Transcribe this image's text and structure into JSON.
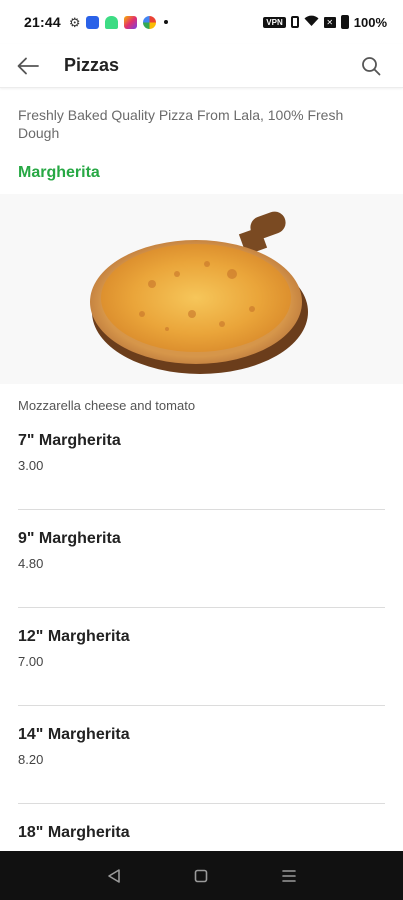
{
  "status_bar": {
    "time": "21:44",
    "battery_text": "100%",
    "vpn_label": "VPN",
    "icons": [
      "gear-icon",
      "blue-app-icon",
      "android-icon",
      "instagram-icon",
      "photos-icon",
      "notification-dot-icon",
      "vibrate-icon",
      "wifi-icon",
      "no-sim-icon",
      "battery-icon"
    ]
  },
  "app_bar": {
    "title": "Pizzas",
    "back_icon": "arrow-left-icon",
    "search_icon": "search-icon"
  },
  "description": "Freshly Baked Quality Pizza From Lala, 100% Fresh Dough",
  "category": {
    "title": "Margherita",
    "color": "#27a844",
    "image": "pizza-margherita-image",
    "description": "Mozzarella cheese and tomato"
  },
  "items": [
    {
      "name": "7\" Margherita",
      "price": "3.00"
    },
    {
      "name": "9\" Margherita",
      "price": "4.80"
    },
    {
      "name": "12\" Margherita",
      "price": "7.00"
    },
    {
      "name": "14\" Margherita",
      "price": "8.20"
    },
    {
      "name": "18\" Margherita",
      "price": ""
    }
  ],
  "nav_bar": {
    "buttons": [
      "back-triangle-icon",
      "home-square-icon",
      "menu-lines-icon"
    ]
  }
}
